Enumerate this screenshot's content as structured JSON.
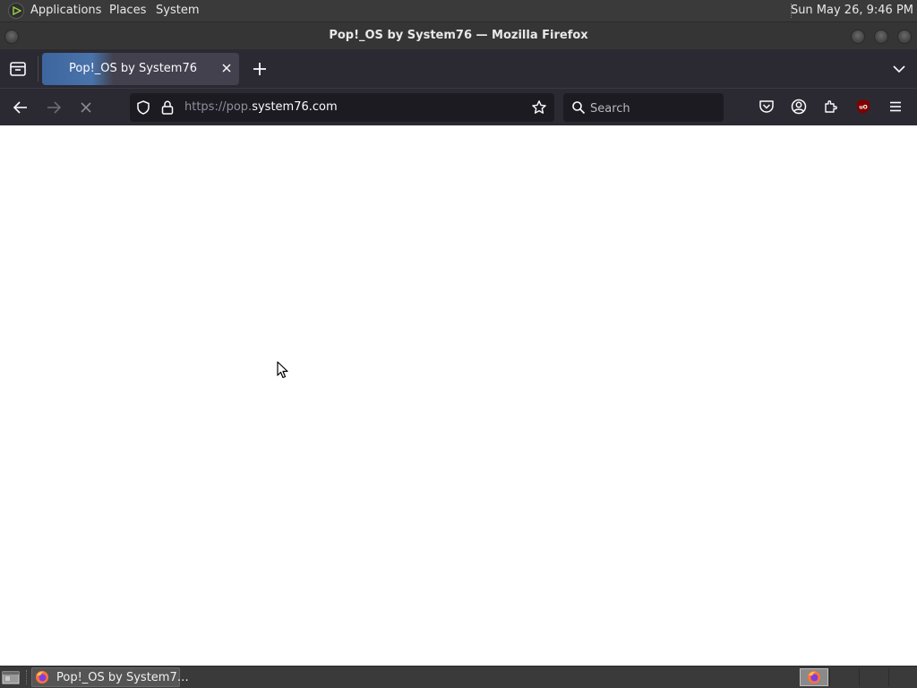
{
  "top_panel": {
    "applications_label": "Applications",
    "places_label": "Places",
    "system_label": "System",
    "clock": "Sun May 26,  9:46 PM"
  },
  "window": {
    "title": "Pop!_OS by System76 — Mozilla Firefox"
  },
  "tabs": [
    {
      "title": "Pop!_OS by System76",
      "active": true,
      "loading": true
    }
  ],
  "navbar": {
    "url_prefix": "https://pop.",
    "url_domain": "system76.com",
    "search_placeholder": "Search"
  },
  "taskbar": {
    "task_label": "Pop!_OS by System7…"
  },
  "colors": {
    "panel": "#3a3a3a",
    "toolbar": "#2b2a33",
    "field": "#1c1b22",
    "loading_accent": "#4a78b5",
    "ublock_red": "#800000"
  },
  "icons": [
    "menu-logo-icon",
    "archive-icon",
    "close-icon",
    "plus-icon",
    "chevron-down-icon",
    "back-arrow-icon",
    "forward-arrow-icon",
    "stop-icon",
    "shield-icon",
    "lock-icon",
    "star-icon",
    "search-icon",
    "pocket-icon",
    "account-icon",
    "extensions-icon",
    "ublock-icon",
    "hamburger-icon",
    "firefox-icon",
    "show-desktop-icon",
    "mouse-cursor"
  ]
}
